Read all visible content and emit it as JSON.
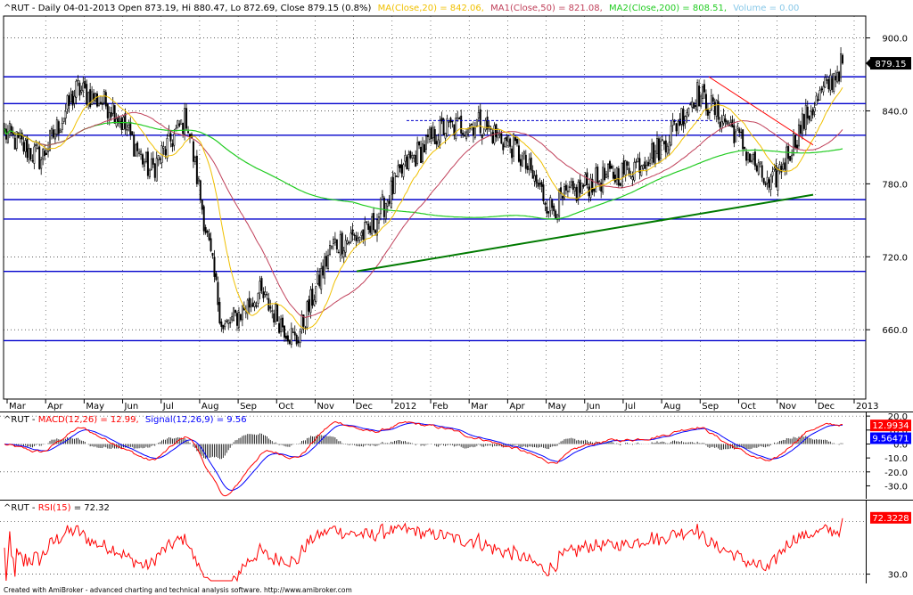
{
  "header": {
    "symbol_line": "^RUT - Daily 04-01-2013 Open 873.19, Hi 880.47, Lo 872.69, Close 879.15 (0.8%)",
    "ma20": "MA(Close,20) = 842.06,",
    "ma50": "MA1(Close,50) = 821.08,",
    "ma200": "MA2(Close,200) = 808.51,",
    "volume": "Volume = 0.00"
  },
  "macd_header": {
    "prefix": "^RUT - ",
    "macd": "MACD(12,26) = 12.99,",
    "signal": "Signal(12,26,9) = 9.56"
  },
  "rsi_header": {
    "prefix": "^RUT - ",
    "rsi": "RSI(15)",
    "value": " = 72.32"
  },
  "footer": "Created with AmiBroker - advanced charting and technical analysis software. http://www.amibroker.com",
  "colors": {
    "price": "#000000",
    "ma20": "#f0c000",
    "ma50": "#c0405a",
    "ma200": "#22cc22",
    "volume": "#88c8e8",
    "hline": "#0000cc",
    "trendline": "#007a00",
    "macd": "#ff0000",
    "signal": "#0000ff",
    "rsi": "#ff0000",
    "close_badge": "#000000",
    "macd_badge": "#ff0000",
    "signal_badge": "#0000ff"
  },
  "chart_data": [
    {
      "type": "candlestick",
      "title": "^RUT - Daily",
      "x_ticks": [
        "Mar",
        "Apr",
        "May",
        "Jun",
        "Jul",
        "Aug",
        "Sep",
        "Oct",
        "Nov",
        "Dec",
        "2012",
        "Feb",
        "Mar",
        "Apr",
        "May",
        "Jun",
        "Jul",
        "Aug",
        "Sep",
        "Oct",
        "Nov",
        "Dec",
        "2013"
      ],
      "y_ticks": [
        660,
        720,
        780,
        840,
        900
      ],
      "ylim": [
        603,
        918
      ],
      "last_close": 879.15,
      "last_close_label": "879.15",
      "horizontal_levels": [
        868,
        846,
        820,
        767,
        751,
        708,
        651
      ],
      "trendlines": [
        {
          "from": [
            "Nov-2011",
            708
          ],
          "to": [
            "Dec-2012",
            771
          ]
        }
      ],
      "close_series_approx": [
        {
          "x": "Feb-2011",
          "y": 822
        },
        {
          "x": "Mar-2011",
          "y": 800
        },
        {
          "x": "Apr-2011",
          "y": 858
        },
        {
          "x": "May-2011",
          "y": 842
        },
        {
          "x": "Jun-2011",
          "y": 790
        },
        {
          "x": "Jul-2011",
          "y": 835
        },
        {
          "x": "Aug-2011",
          "y": 660
        },
        {
          "x": "Sep-2011",
          "y": 690
        },
        {
          "x": "Oct-2011",
          "y": 650
        },
        {
          "x": "Nov-2011",
          "y": 730
        },
        {
          "x": "Dec-2011",
          "y": 740
        },
        {
          "x": "Jan-2012",
          "y": 795
        },
        {
          "x": "Feb-2012",
          "y": 825
        },
        {
          "x": "Mar-2012",
          "y": 830
        },
        {
          "x": "Apr-2012",
          "y": 810
        },
        {
          "x": "May-2012",
          "y": 760
        },
        {
          "x": "Jun-2012",
          "y": 780
        },
        {
          "x": "Jul-2012",
          "y": 790
        },
        {
          "x": "Aug-2012",
          "y": 810
        },
        {
          "x": "Sep-2012",
          "y": 855
        },
        {
          "x": "Oct-2012",
          "y": 825
        },
        {
          "x": "Nov-2012",
          "y": 775
        },
        {
          "x": "Dec-2012",
          "y": 835
        },
        {
          "x": "Jan-2013",
          "y": 879
        }
      ],
      "series": [
        {
          "name": "MA(Close,20)",
          "value": 842.06
        },
        {
          "name": "MA1(Close,50)",
          "value": 821.08
        },
        {
          "name": "MA2(Close,200)",
          "value": 808.51
        },
        {
          "name": "Volume",
          "value": 0.0
        }
      ]
    },
    {
      "type": "line",
      "title": "MACD(12,26)",
      "y_ticks": [
        20.0,
        10.0,
        0.0,
        -10.0,
        -20.0,
        -30.0
      ],
      "y_tick_labels": [
        "20.0",
        "10.0",
        "0.0",
        "-10.0",
        "-20.0",
        "-30.0"
      ],
      "ylim": [
        -38,
        22
      ],
      "macd_label": "12.9934",
      "signal_label": "9.56471",
      "series": [
        {
          "name": "MACD(12,26)",
          "last": 12.99
        },
        {
          "name": "Signal(12,26,9)",
          "last": 9.56
        }
      ]
    },
    {
      "type": "line",
      "title": "RSI(15)",
      "y_ticks": [
        30.0
      ],
      "y_tick_labels": [
        "30.0"
      ],
      "ylim": [
        25,
        85
      ],
      "last_label": "72.3228",
      "series": [
        {
          "name": "RSI(15)",
          "last": 72.32
        }
      ]
    }
  ]
}
